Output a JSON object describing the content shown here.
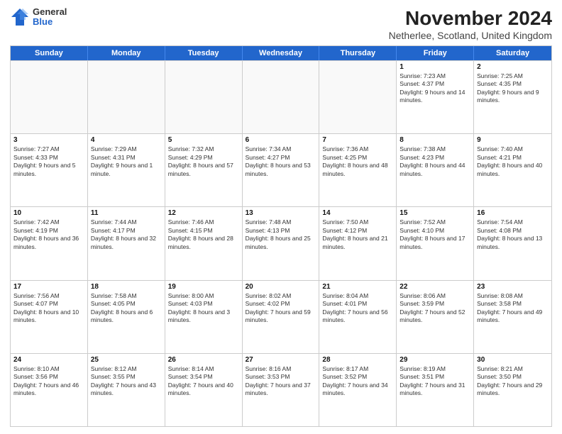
{
  "header": {
    "logo": {
      "general": "General",
      "blue": "Blue"
    },
    "title": "November 2024",
    "subtitle": "Netherlee, Scotland, United Kingdom"
  },
  "calendar": {
    "weekdays": [
      "Sunday",
      "Monday",
      "Tuesday",
      "Wednesday",
      "Thursday",
      "Friday",
      "Saturday"
    ],
    "weeks": [
      [
        {
          "day": "",
          "info": ""
        },
        {
          "day": "",
          "info": ""
        },
        {
          "day": "",
          "info": ""
        },
        {
          "day": "",
          "info": ""
        },
        {
          "day": "",
          "info": ""
        },
        {
          "day": "1",
          "info": "Sunrise: 7:23 AM\nSunset: 4:37 PM\nDaylight: 9 hours and 14 minutes."
        },
        {
          "day": "2",
          "info": "Sunrise: 7:25 AM\nSunset: 4:35 PM\nDaylight: 9 hours and 9 minutes."
        }
      ],
      [
        {
          "day": "3",
          "info": "Sunrise: 7:27 AM\nSunset: 4:33 PM\nDaylight: 9 hours and 5 minutes."
        },
        {
          "day": "4",
          "info": "Sunrise: 7:29 AM\nSunset: 4:31 PM\nDaylight: 9 hours and 1 minute."
        },
        {
          "day": "5",
          "info": "Sunrise: 7:32 AM\nSunset: 4:29 PM\nDaylight: 8 hours and 57 minutes."
        },
        {
          "day": "6",
          "info": "Sunrise: 7:34 AM\nSunset: 4:27 PM\nDaylight: 8 hours and 53 minutes."
        },
        {
          "day": "7",
          "info": "Sunrise: 7:36 AM\nSunset: 4:25 PM\nDaylight: 8 hours and 48 minutes."
        },
        {
          "day": "8",
          "info": "Sunrise: 7:38 AM\nSunset: 4:23 PM\nDaylight: 8 hours and 44 minutes."
        },
        {
          "day": "9",
          "info": "Sunrise: 7:40 AM\nSunset: 4:21 PM\nDaylight: 8 hours and 40 minutes."
        }
      ],
      [
        {
          "day": "10",
          "info": "Sunrise: 7:42 AM\nSunset: 4:19 PM\nDaylight: 8 hours and 36 minutes."
        },
        {
          "day": "11",
          "info": "Sunrise: 7:44 AM\nSunset: 4:17 PM\nDaylight: 8 hours and 32 minutes."
        },
        {
          "day": "12",
          "info": "Sunrise: 7:46 AM\nSunset: 4:15 PM\nDaylight: 8 hours and 28 minutes."
        },
        {
          "day": "13",
          "info": "Sunrise: 7:48 AM\nSunset: 4:13 PM\nDaylight: 8 hours and 25 minutes."
        },
        {
          "day": "14",
          "info": "Sunrise: 7:50 AM\nSunset: 4:12 PM\nDaylight: 8 hours and 21 minutes."
        },
        {
          "day": "15",
          "info": "Sunrise: 7:52 AM\nSunset: 4:10 PM\nDaylight: 8 hours and 17 minutes."
        },
        {
          "day": "16",
          "info": "Sunrise: 7:54 AM\nSunset: 4:08 PM\nDaylight: 8 hours and 13 minutes."
        }
      ],
      [
        {
          "day": "17",
          "info": "Sunrise: 7:56 AM\nSunset: 4:07 PM\nDaylight: 8 hours and 10 minutes."
        },
        {
          "day": "18",
          "info": "Sunrise: 7:58 AM\nSunset: 4:05 PM\nDaylight: 8 hours and 6 minutes."
        },
        {
          "day": "19",
          "info": "Sunrise: 8:00 AM\nSunset: 4:03 PM\nDaylight: 8 hours and 3 minutes."
        },
        {
          "day": "20",
          "info": "Sunrise: 8:02 AM\nSunset: 4:02 PM\nDaylight: 7 hours and 59 minutes."
        },
        {
          "day": "21",
          "info": "Sunrise: 8:04 AM\nSunset: 4:01 PM\nDaylight: 7 hours and 56 minutes."
        },
        {
          "day": "22",
          "info": "Sunrise: 8:06 AM\nSunset: 3:59 PM\nDaylight: 7 hours and 52 minutes."
        },
        {
          "day": "23",
          "info": "Sunrise: 8:08 AM\nSunset: 3:58 PM\nDaylight: 7 hours and 49 minutes."
        }
      ],
      [
        {
          "day": "24",
          "info": "Sunrise: 8:10 AM\nSunset: 3:56 PM\nDaylight: 7 hours and 46 minutes."
        },
        {
          "day": "25",
          "info": "Sunrise: 8:12 AM\nSunset: 3:55 PM\nDaylight: 7 hours and 43 minutes."
        },
        {
          "day": "26",
          "info": "Sunrise: 8:14 AM\nSunset: 3:54 PM\nDaylight: 7 hours and 40 minutes."
        },
        {
          "day": "27",
          "info": "Sunrise: 8:16 AM\nSunset: 3:53 PM\nDaylight: 7 hours and 37 minutes."
        },
        {
          "day": "28",
          "info": "Sunrise: 8:17 AM\nSunset: 3:52 PM\nDaylight: 7 hours and 34 minutes."
        },
        {
          "day": "29",
          "info": "Sunrise: 8:19 AM\nSunset: 3:51 PM\nDaylight: 7 hours and 31 minutes."
        },
        {
          "day": "30",
          "info": "Sunrise: 8:21 AM\nSunset: 3:50 PM\nDaylight: 7 hours and 29 minutes."
        }
      ]
    ]
  }
}
